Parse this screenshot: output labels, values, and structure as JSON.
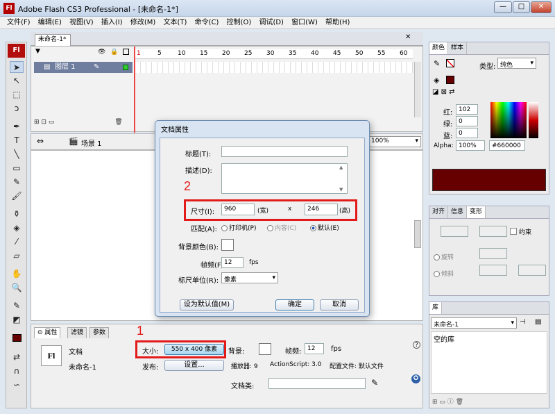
{
  "window": {
    "title": "Adobe Flash CS3 Professional - [未命名-1*]",
    "icon": "Fl",
    "min": "—",
    "max": "□",
    "close": "✕"
  },
  "menu": [
    "文件(F)",
    "编辑(E)",
    "视图(V)",
    "插入(I)",
    "修改(M)",
    "文本(T)",
    "命令(C)",
    "控制(O)",
    "调试(D)",
    "窗口(W)",
    "帮助(H)"
  ],
  "toolbox": {
    "logo": "Fl",
    "tools": [
      "selection-tool",
      "subselection-tool",
      "free-transform-tool",
      "lasso-tool",
      "pen-tool",
      "text-tool",
      "line-tool",
      "rectangle-tool",
      "pencil-tool",
      "brush-tool",
      "ink-bottle-tool",
      "paint-bucket-tool",
      "eyedropper-tool",
      "eraser-tool",
      "hand-tool",
      "zoom-tool",
      "stroke-color-tool",
      "fill-color-tool"
    ]
  },
  "document": {
    "tab": "未命名-1*"
  },
  "timeline": {
    "frame_numbers": [
      "1",
      "5",
      "10",
      "15",
      "20",
      "25",
      "30",
      "35",
      "40",
      "45",
      "50",
      "55",
      "60"
    ],
    "layer": "图层 1"
  },
  "scene": {
    "name": "场景 1",
    "zoom": "100%"
  },
  "properties": {
    "tabs": [
      "属性",
      "滤镜",
      "参数"
    ],
    "doc_type": "文档",
    "doc_icon": "Fl",
    "doc_name": "未命名-1",
    "size_label": "大小:",
    "size_value": "550 x 400 像素",
    "bg_label": "背景:",
    "fps_label": "帧频:",
    "fps_value": "12",
    "fps_unit": "fps",
    "publish_label": "发布:",
    "settings_button": "设置...",
    "player_label": "播放器: 9",
    "as_label": "ActionScript: 3.0",
    "profile_label": "配置文件: 默认文件",
    "docclass_label": "文档类:"
  },
  "dialog": {
    "title": "文档属性",
    "title_label": "标题(T):",
    "desc_label": "描述(D):",
    "dims_label": "尺寸(I):",
    "width": "960",
    "width_unit": "(宽)",
    "x": "x",
    "height": "246",
    "height_unit": "(高)",
    "match_label": "匹配(A):",
    "match_options": [
      "打印机(P)",
      "内容(C)",
      "默认(E)"
    ],
    "match_selected": 2,
    "bg_label": "背景颜色(B):",
    "fps_label": "帧频(F):",
    "fps_value": "12",
    "fps_unit": "fps",
    "ruler_label": "标尺单位(R):",
    "ruler_value": "像素",
    "default_button": "设为默认值(M)",
    "ok_button": "确定",
    "cancel_button": "取消"
  },
  "annotations": {
    "one": "1",
    "two": "2"
  },
  "color_panel": {
    "tabs": [
      "颜色",
      "样本"
    ],
    "type_label": "类型:",
    "type_value": "纯色",
    "red_label": "红:",
    "red": "102",
    "green_label": "绿:",
    "green": "0",
    "blue_label": "蓝:",
    "blue": "0",
    "alpha_label": "Alpha:",
    "alpha": "100%",
    "hex": "#660000",
    "color": "#660000"
  },
  "transform_panel": {
    "tabs": [
      "对齐",
      "信息",
      "变形"
    ],
    "constrain": "约束",
    "rotate": "旋转",
    "skew": "倾斜"
  },
  "library_panel": {
    "tabs": [
      "库"
    ],
    "doc": "未命名-1",
    "empty": "空的库"
  }
}
